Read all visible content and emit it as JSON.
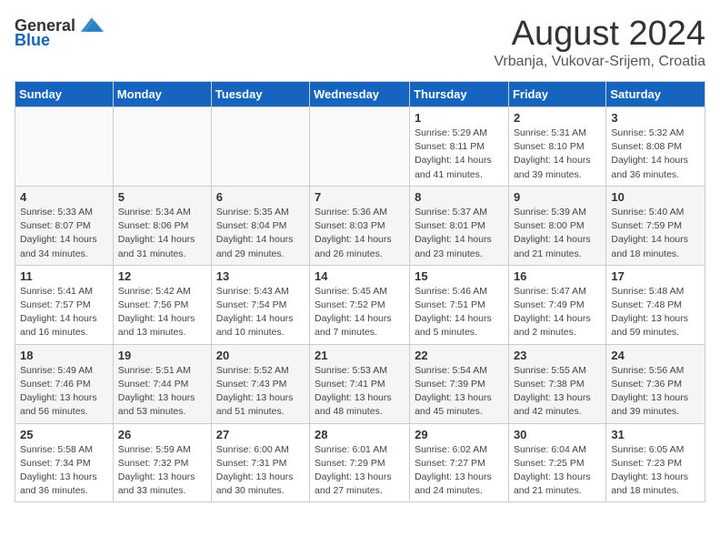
{
  "header": {
    "logo": {
      "general": "General",
      "blue": "Blue"
    },
    "title": "August 2024",
    "location": "Vrbanja, Vukovar-Srijem, Croatia"
  },
  "weekdays": [
    "Sunday",
    "Monday",
    "Tuesday",
    "Wednesday",
    "Thursday",
    "Friday",
    "Saturday"
  ],
  "weeks": [
    {
      "row": 1,
      "days": [
        {
          "num": "",
          "info": ""
        },
        {
          "num": "",
          "info": ""
        },
        {
          "num": "",
          "info": ""
        },
        {
          "num": "",
          "info": ""
        },
        {
          "num": "1",
          "info": "Sunrise: 5:29 AM\nSunset: 8:11 PM\nDaylight: 14 hours\nand 41 minutes."
        },
        {
          "num": "2",
          "info": "Sunrise: 5:31 AM\nSunset: 8:10 PM\nDaylight: 14 hours\nand 39 minutes."
        },
        {
          "num": "3",
          "info": "Sunrise: 5:32 AM\nSunset: 8:08 PM\nDaylight: 14 hours\nand 36 minutes."
        }
      ]
    },
    {
      "row": 2,
      "days": [
        {
          "num": "4",
          "info": "Sunrise: 5:33 AM\nSunset: 8:07 PM\nDaylight: 14 hours\nand 34 minutes."
        },
        {
          "num": "5",
          "info": "Sunrise: 5:34 AM\nSunset: 8:06 PM\nDaylight: 14 hours\nand 31 minutes."
        },
        {
          "num": "6",
          "info": "Sunrise: 5:35 AM\nSunset: 8:04 PM\nDaylight: 14 hours\nand 29 minutes."
        },
        {
          "num": "7",
          "info": "Sunrise: 5:36 AM\nSunset: 8:03 PM\nDaylight: 14 hours\nand 26 minutes."
        },
        {
          "num": "8",
          "info": "Sunrise: 5:37 AM\nSunset: 8:01 PM\nDaylight: 14 hours\nand 23 minutes."
        },
        {
          "num": "9",
          "info": "Sunrise: 5:39 AM\nSunset: 8:00 PM\nDaylight: 14 hours\nand 21 minutes."
        },
        {
          "num": "10",
          "info": "Sunrise: 5:40 AM\nSunset: 7:59 PM\nDaylight: 14 hours\nand 18 minutes."
        }
      ]
    },
    {
      "row": 3,
      "days": [
        {
          "num": "11",
          "info": "Sunrise: 5:41 AM\nSunset: 7:57 PM\nDaylight: 14 hours\nand 16 minutes."
        },
        {
          "num": "12",
          "info": "Sunrise: 5:42 AM\nSunset: 7:56 PM\nDaylight: 14 hours\nand 13 minutes."
        },
        {
          "num": "13",
          "info": "Sunrise: 5:43 AM\nSunset: 7:54 PM\nDaylight: 14 hours\nand 10 minutes."
        },
        {
          "num": "14",
          "info": "Sunrise: 5:45 AM\nSunset: 7:52 PM\nDaylight: 14 hours\nand 7 minutes."
        },
        {
          "num": "15",
          "info": "Sunrise: 5:46 AM\nSunset: 7:51 PM\nDaylight: 14 hours\nand 5 minutes."
        },
        {
          "num": "16",
          "info": "Sunrise: 5:47 AM\nSunset: 7:49 PM\nDaylight: 14 hours\nand 2 minutes."
        },
        {
          "num": "17",
          "info": "Sunrise: 5:48 AM\nSunset: 7:48 PM\nDaylight: 13 hours\nand 59 minutes."
        }
      ]
    },
    {
      "row": 4,
      "days": [
        {
          "num": "18",
          "info": "Sunrise: 5:49 AM\nSunset: 7:46 PM\nDaylight: 13 hours\nand 56 minutes."
        },
        {
          "num": "19",
          "info": "Sunrise: 5:51 AM\nSunset: 7:44 PM\nDaylight: 13 hours\nand 53 minutes."
        },
        {
          "num": "20",
          "info": "Sunrise: 5:52 AM\nSunset: 7:43 PM\nDaylight: 13 hours\nand 51 minutes."
        },
        {
          "num": "21",
          "info": "Sunrise: 5:53 AM\nSunset: 7:41 PM\nDaylight: 13 hours\nand 48 minutes."
        },
        {
          "num": "22",
          "info": "Sunrise: 5:54 AM\nSunset: 7:39 PM\nDaylight: 13 hours\nand 45 minutes."
        },
        {
          "num": "23",
          "info": "Sunrise: 5:55 AM\nSunset: 7:38 PM\nDaylight: 13 hours\nand 42 minutes."
        },
        {
          "num": "24",
          "info": "Sunrise: 5:56 AM\nSunset: 7:36 PM\nDaylight: 13 hours\nand 39 minutes."
        }
      ]
    },
    {
      "row": 5,
      "days": [
        {
          "num": "25",
          "info": "Sunrise: 5:58 AM\nSunset: 7:34 PM\nDaylight: 13 hours\nand 36 minutes."
        },
        {
          "num": "26",
          "info": "Sunrise: 5:59 AM\nSunset: 7:32 PM\nDaylight: 13 hours\nand 33 minutes."
        },
        {
          "num": "27",
          "info": "Sunrise: 6:00 AM\nSunset: 7:31 PM\nDaylight: 13 hours\nand 30 minutes."
        },
        {
          "num": "28",
          "info": "Sunrise: 6:01 AM\nSunset: 7:29 PM\nDaylight: 13 hours\nand 27 minutes."
        },
        {
          "num": "29",
          "info": "Sunrise: 6:02 AM\nSunset: 7:27 PM\nDaylight: 13 hours\nand 24 minutes."
        },
        {
          "num": "30",
          "info": "Sunrise: 6:04 AM\nSunset: 7:25 PM\nDaylight: 13 hours\nand 21 minutes."
        },
        {
          "num": "31",
          "info": "Sunrise: 6:05 AM\nSunset: 7:23 PM\nDaylight: 13 hours\nand 18 minutes."
        }
      ]
    }
  ]
}
